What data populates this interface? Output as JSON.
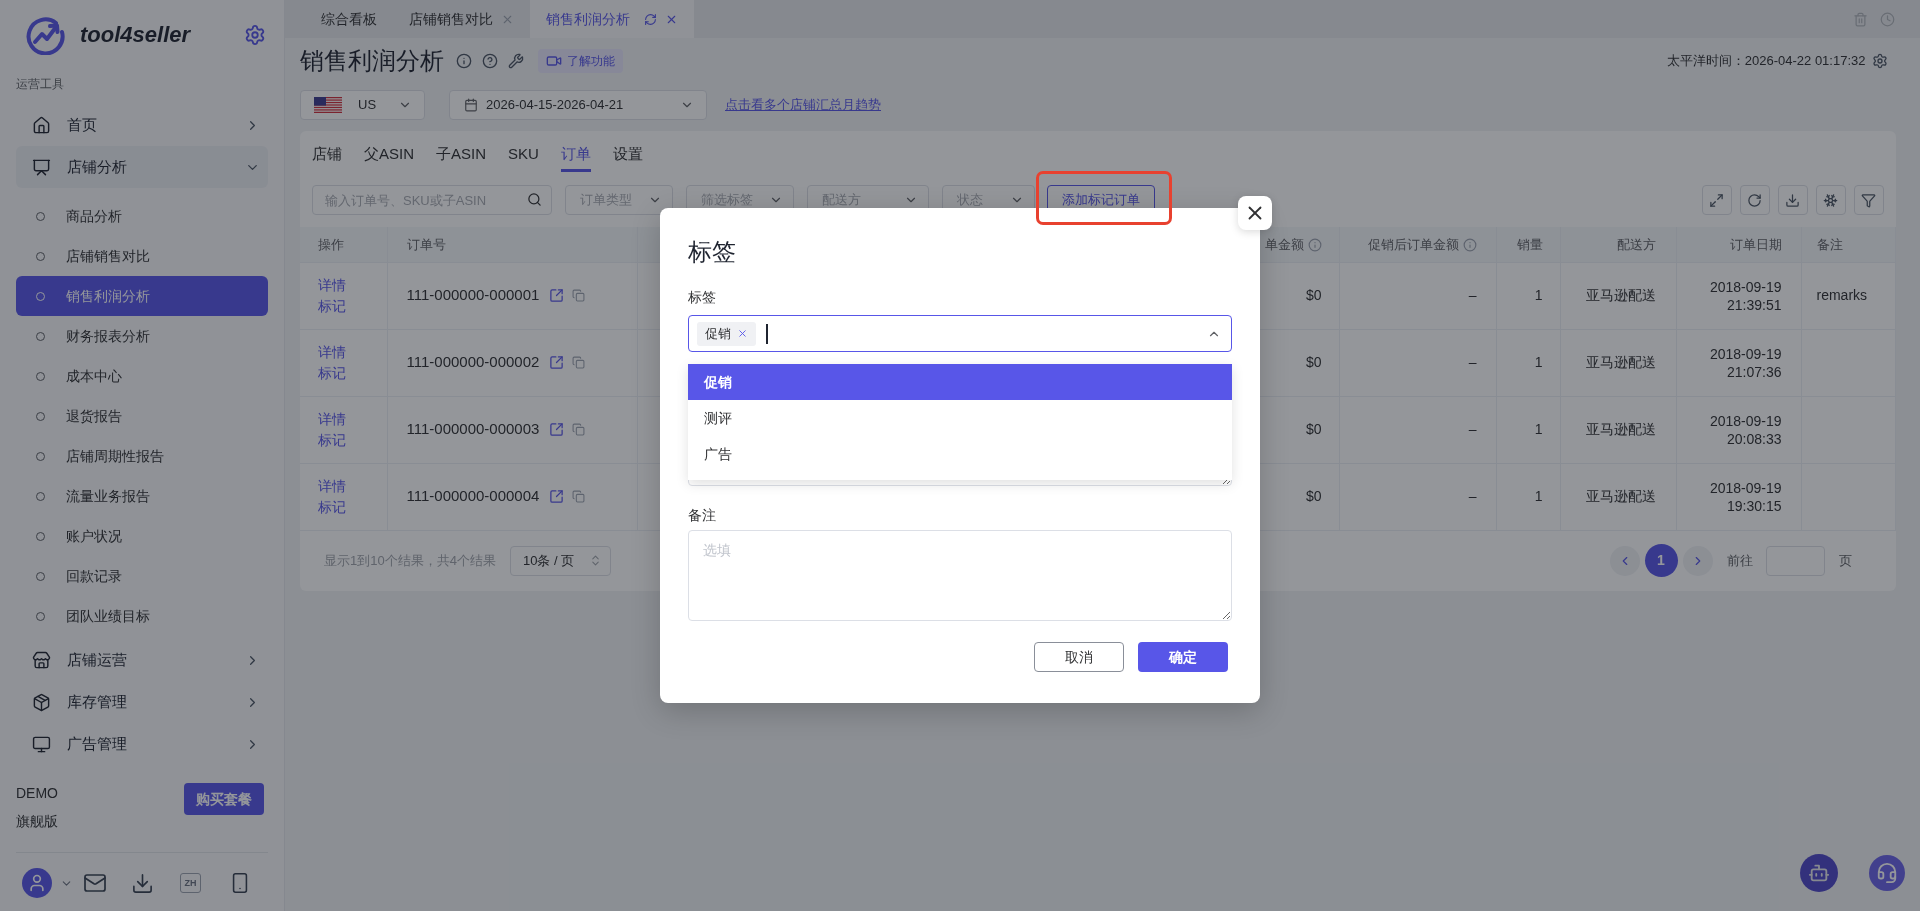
{
  "sidebar": {
    "brand": "tool4seller",
    "section_label": "运营工具",
    "nav": [
      {
        "label": "首页",
        "expanded": false
      },
      {
        "label": "店铺分析",
        "expanded": true,
        "children": [
          {
            "label": "商品分析",
            "selected": false
          },
          {
            "label": "店铺销售对比",
            "selected": false
          },
          {
            "label": "销售利润分析",
            "selected": true
          },
          {
            "label": "财务报表分析",
            "selected": false
          },
          {
            "label": "成本中心",
            "selected": false
          },
          {
            "label": "退货报告",
            "selected": false
          },
          {
            "label": "店铺周期性报告",
            "selected": false
          },
          {
            "label": "流量业务报告",
            "selected": false
          },
          {
            "label": "账户状况",
            "selected": false
          },
          {
            "label": "回款记录",
            "selected": false
          },
          {
            "label": "团队业绩目标",
            "selected": false
          }
        ]
      },
      {
        "label": "店铺运营",
        "expanded": false
      },
      {
        "label": "库存管理",
        "expanded": false
      },
      {
        "label": "广告管理",
        "expanded": false
      }
    ],
    "plan": {
      "name": "DEMO",
      "tier": "旗舰版",
      "buy_button": "购买套餐"
    },
    "language": "ZH"
  },
  "tabs": [
    {
      "label": "综合看板",
      "selected": false,
      "closable": false
    },
    {
      "label": "店铺销售对比",
      "selected": false,
      "closable": true
    },
    {
      "label": "销售利润分析",
      "selected": true,
      "closable": true
    }
  ],
  "header": {
    "title": "销售利润分析",
    "learn_button": "了解功能",
    "clock": "太平洋时间：2026-04-22 01:17:32",
    "marketplace": "US",
    "date_range": "2026-04-15-2026-04-21",
    "summary_link": "点击看多个店铺汇总月趋势"
  },
  "sub_tabs": [
    {
      "label": "店铺",
      "selected": false
    },
    {
      "label": "父ASIN",
      "selected": false
    },
    {
      "label": "子ASIN",
      "selected": false
    },
    {
      "label": "SKU",
      "selected": false
    },
    {
      "label": "订单",
      "selected": true
    },
    {
      "label": "设置",
      "selected": false
    }
  ],
  "filters": {
    "search": {
      "placeholder": "输入订单号、SKU或子ASIN"
    },
    "selects": [
      {
        "placeholder": "订单类型"
      },
      {
        "placeholder": "筛选标签"
      },
      {
        "placeholder": "配送方"
      },
      {
        "placeholder": "状态"
      }
    ],
    "add_button": "添加标记订单"
  },
  "table": {
    "columns": [
      {
        "label": "操作",
        "info": false
      },
      {
        "label": "订单号",
        "info": false
      },
      {
        "label": "单金额",
        "info": true
      },
      {
        "label": "促销后订单金额",
        "info": true
      },
      {
        "label": "销量",
        "info": false
      },
      {
        "label": "配送方",
        "info": false
      },
      {
        "label": "订单日期",
        "info": false
      },
      {
        "label": "备注",
        "info": false
      }
    ],
    "rows": [
      {
        "actions": [
          "详情",
          "标记"
        ],
        "order_no": "111-000000-000001",
        "amount": "$0",
        "promo_amount": "–",
        "quantity": "1",
        "fulfillment": "亚马逊配送",
        "order_date": "2018-09-19 21:39:51",
        "remarks": "remarks"
      },
      {
        "actions": [
          "详情",
          "标记"
        ],
        "order_no": "111-000000-000002",
        "amount": "$0",
        "promo_amount": "–",
        "quantity": "1",
        "fulfillment": "亚马逊配送",
        "order_date": "2018-09-19 21:07:36"
      },
      {
        "actions": [
          "详情",
          "标记"
        ],
        "order_no": "111-000000-000003",
        "amount": "$0",
        "promo_amount": "–",
        "quantity": "1",
        "fulfillment": "亚马逊配送",
        "order_date": "2018-09-19 20:08:33"
      },
      {
        "actions": [
          "详情",
          "标记"
        ],
        "order_no": "111-000000-000004",
        "amount": "$0",
        "promo_amount": "–",
        "quantity": "1",
        "fulfillment": "亚马逊配送",
        "order_date": "2018-09-19 19:30:15"
      }
    ]
  },
  "pagination": {
    "summary": "显示1到10个结果，共4个结果",
    "page_size": "10条 / 页",
    "pages": [
      {
        "label": "1",
        "selected": true
      }
    ],
    "goto_label": "前往",
    "page_suffix": "页"
  },
  "dialog": {
    "title": "标签",
    "tag_label": "标签",
    "chips": [
      "促销"
    ],
    "options": [
      {
        "label": "促销",
        "selected": true
      },
      {
        "label": "测评",
        "selected": false
      },
      {
        "label": "广告",
        "selected": false
      }
    ],
    "remarks_label": "备注",
    "remarks_placeholder": "选填",
    "cancel_button": "取消",
    "confirm_button": "确定"
  }
}
